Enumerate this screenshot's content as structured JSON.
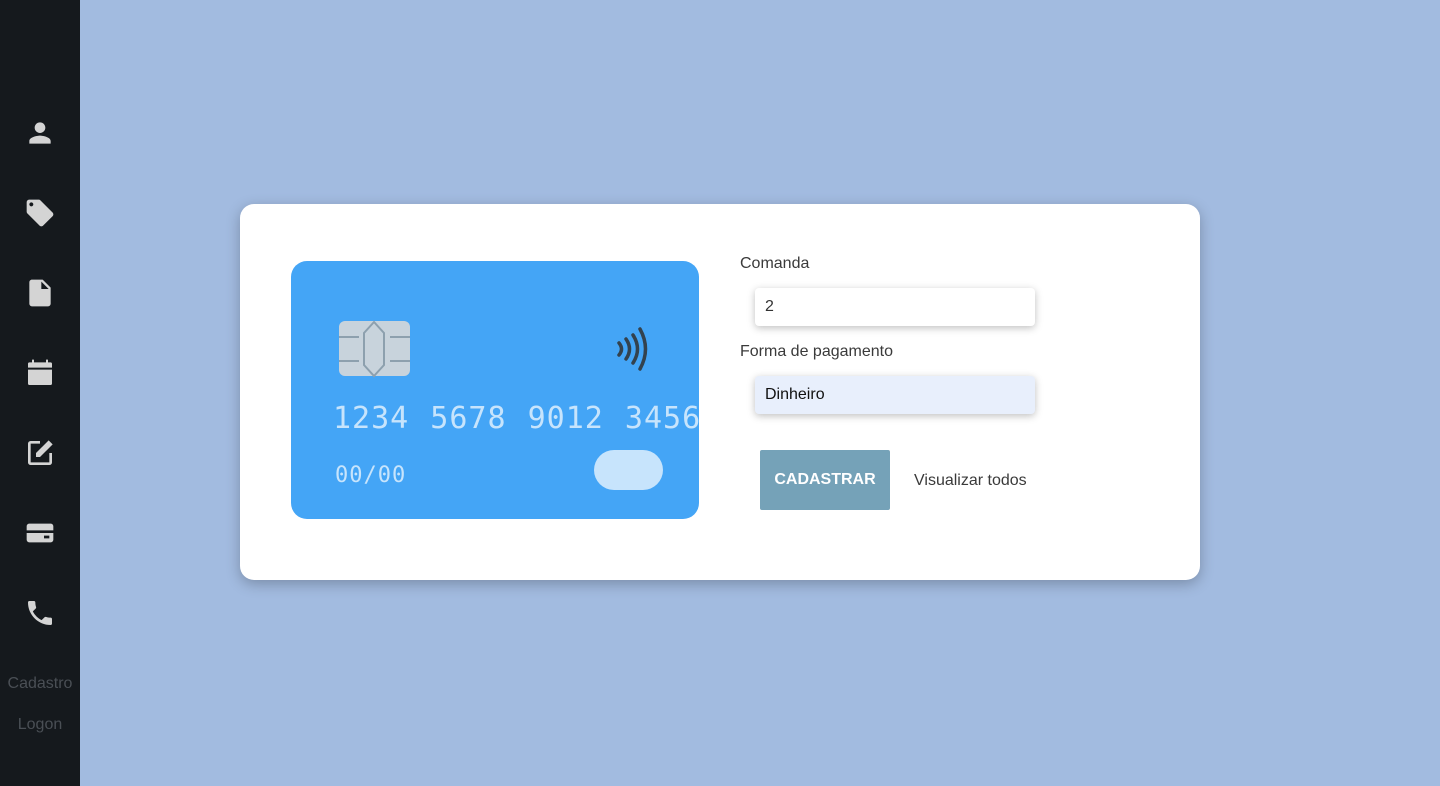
{
  "sidebar": {
    "icons": [
      "user-icon",
      "tag-icon",
      "file-icon",
      "calendar-icon",
      "edit-icon",
      "card-icon",
      "phone-icon"
    ],
    "links": [
      {
        "label": "Cadastro"
      },
      {
        "label": "Logon"
      }
    ]
  },
  "card": {
    "number": "1234 5678 9012 3456",
    "expiry": "00/00",
    "color": "#44a5f6"
  },
  "form": {
    "comanda_label": "Comanda",
    "comanda_value": "2",
    "pagamento_label": "Forma de pagamento",
    "pagamento_value": "Dinheiro",
    "submit_label": "CADASTRAR",
    "view_all_label": "Visualizar todos"
  },
  "colors": {
    "background": "#a2bbe0",
    "sidebar": "#15191d",
    "button": "#75a2b8"
  }
}
